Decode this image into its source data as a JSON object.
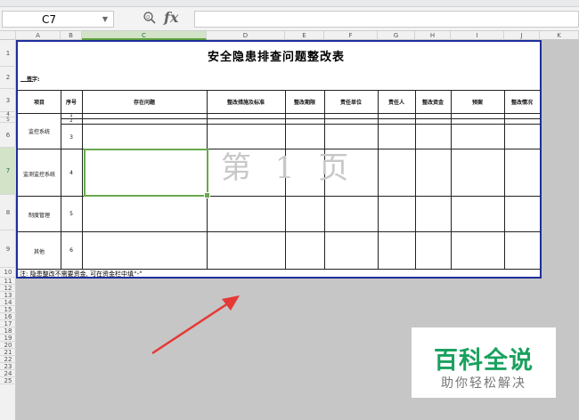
{
  "formula_bar": {
    "name_box": "C7",
    "fx_label": "fx"
  },
  "columns": [
    "A",
    "B",
    "C",
    "D",
    "E",
    "F",
    "G",
    "H",
    "I",
    "J",
    "K"
  ],
  "rows": [
    "1",
    "2",
    "3",
    "4",
    "5",
    "6",
    "7",
    "8",
    "9",
    "10",
    "11",
    "12",
    "13",
    "14",
    "15",
    "16",
    "17",
    "18",
    "19",
    "20",
    "21",
    "22",
    "23",
    "24",
    "25"
  ],
  "sheet": {
    "title": "安全隐患排查问题整改表",
    "signer_label": "签字:",
    "headers": [
      "项目",
      "序号",
      "存在问题",
      "整改措施及标准",
      "整改期限",
      "责任单位",
      "责任人",
      "整改资金",
      "预案",
      "整改情况"
    ],
    "items": [
      {
        "project": "监控系统",
        "numbers": [
          "1",
          "2",
          "3"
        ]
      },
      {
        "project": "监测监控系统",
        "numbers": [
          "4"
        ]
      },
      {
        "project": "制度管理",
        "numbers": [
          "5"
        ]
      },
      {
        "project": "其他",
        "numbers": [
          "6"
        ]
      }
    ],
    "footnote": "注: 隐患整改不需要资金, 可在资金栏中填“-”",
    "watermark": "第 1 页"
  },
  "logo": {
    "line1": "百科全说",
    "line2": "助你轻松解决",
    "color": "#1aa15f"
  },
  "colors": {
    "selection": "#6aa84f",
    "page_border": "#1e2e9a",
    "arrow": "#e53935"
  }
}
